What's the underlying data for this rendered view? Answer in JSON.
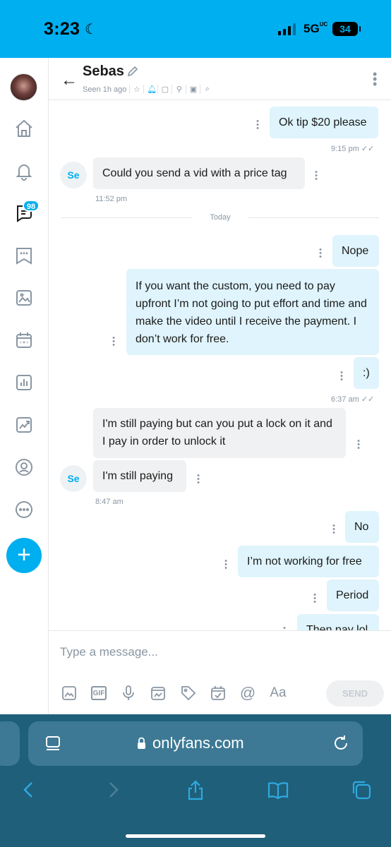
{
  "status_bar": {
    "time": "3:23",
    "network": "5G",
    "network_suffix": "UC",
    "battery": "34"
  },
  "sidebar": {
    "messages_badge": "98"
  },
  "chat_header": {
    "name": "Sebas",
    "last_seen": "Seen 1h ago"
  },
  "messages": {
    "avatar_initials": "Se",
    "m1": {
      "text": "Ok tip $20 please",
      "time": "9:15 pm"
    },
    "m2": {
      "text": "Could you send a vid with a price tag",
      "time": "11:52 pm"
    },
    "day_separator": "Today",
    "m3": {
      "text": "Nope"
    },
    "m4": {
      "text": "If you want the custom, you need to pay upfront I’m not going to put effort and time and make the video until I receive the payment. I don’t work for free."
    },
    "m5": {
      "text": ":)",
      "time": "6:37 am"
    },
    "m6": {
      "text": "I'm still paying but can you put a lock on it and I pay in order to unlock it"
    },
    "m7": {
      "text": "I'm still paying",
      "time": "8:47 am"
    },
    "m8": {
      "text": "No"
    },
    "m9": {
      "text": "I’m not working for free"
    },
    "m10": {
      "text": "Period"
    },
    "m11": {
      "text": "Then pay lol"
    }
  },
  "composer": {
    "placeholder": "Type a message...",
    "gif_label": "GIF",
    "at_label": "@",
    "text_format_label": "Aa",
    "send_label": "SEND"
  },
  "browser": {
    "url": "onlyfans.com"
  },
  "colors": {
    "accent": "#00aff0",
    "outgoing_bubble": "#dff4fc",
    "incoming_bubble": "#f0f1f2",
    "browser_bar": "#1f5f7a"
  }
}
